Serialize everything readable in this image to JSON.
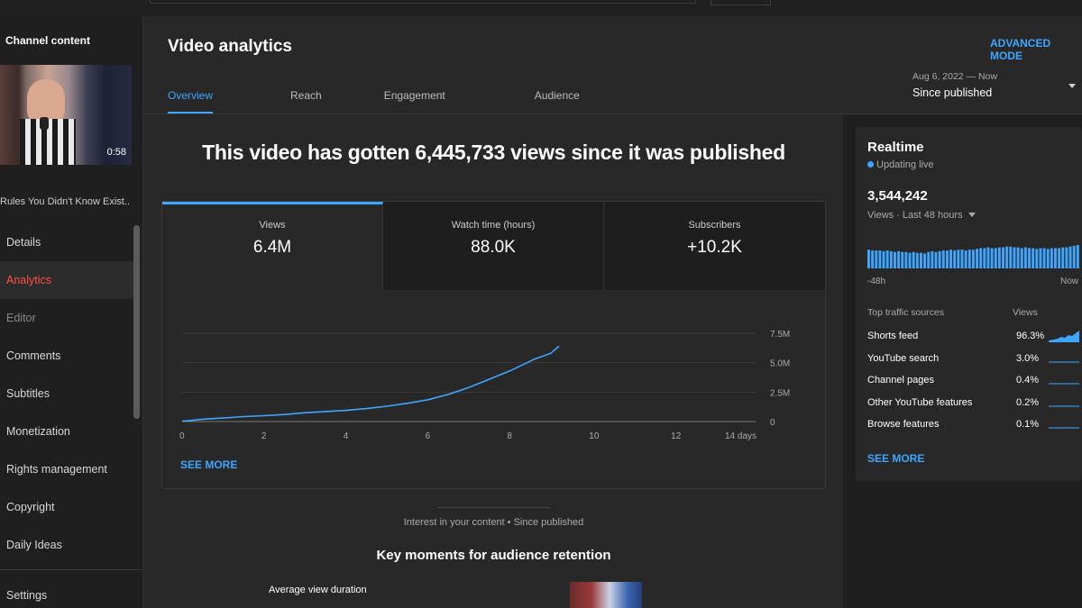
{
  "sidebar": {
    "title": "Channel content",
    "video_duration": "0:58",
    "video_title": "Rules You Didn't Know Exist..",
    "nav": [
      {
        "label": "Details",
        "state": "normal"
      },
      {
        "label": "Analytics",
        "state": "active"
      },
      {
        "label": "Editor",
        "state": "disabled"
      },
      {
        "label": "Comments",
        "state": "normal"
      },
      {
        "label": "Subtitles",
        "state": "normal"
      },
      {
        "label": "Monetization",
        "state": "normal"
      },
      {
        "label": "Rights management",
        "state": "normal"
      },
      {
        "label": "Copyright",
        "state": "normal"
      },
      {
        "label": "Daily Ideas",
        "state": "normal"
      }
    ],
    "settings": "Settings"
  },
  "header": {
    "title": "Video analytics",
    "advanced_mode": "ADVANCED MODE",
    "tabs": [
      {
        "label": "Overview",
        "active": true
      },
      {
        "label": "Reach",
        "active": false
      },
      {
        "label": "Engagement",
        "active": false
      },
      {
        "label": "Audience",
        "active": false
      }
    ],
    "date_range_sub": "Aug 6, 2022 — Now",
    "date_range": "Since published"
  },
  "main": {
    "headline": "This video has gotten 6,445,733 views since it was published",
    "metrics": [
      {
        "label": "Views",
        "value": "6.4M",
        "active": true
      },
      {
        "label": "Watch time (hours)",
        "value": "88.0K",
        "active": false
      },
      {
        "label": "Subscribers",
        "value": "+10.2K",
        "active": false
      }
    ],
    "see_more": "SEE MORE",
    "interest_caption": "Interest in your content • Since published",
    "retention_title": "Key moments for audience retention",
    "avg_view_duration": "Average view duration"
  },
  "chart_data": {
    "type": "line",
    "series": [
      {
        "x": [
          0,
          0.5,
          1,
          1.5,
          2,
          2.5,
          3,
          3.5,
          4,
          4.5,
          5,
          5.5,
          6,
          6.5,
          7,
          7.5,
          8,
          8.3,
          8.6,
          9.0,
          9.2
        ],
        "values": [
          0.02,
          0.2,
          0.3,
          0.42,
          0.5,
          0.6,
          0.75,
          0.85,
          0.95,
          1.1,
          1.3,
          1.55,
          1.85,
          2.3,
          2.9,
          3.6,
          4.3,
          4.8,
          5.3,
          5.8,
          6.4
        ]
      }
    ],
    "x_ticks": [
      "0",
      "2",
      "4",
      "6",
      "8",
      "10",
      "12",
      "14 days"
    ],
    "y_ticks": [
      "0",
      "2.5M",
      "5.0M",
      "7.5M"
    ],
    "xlim": [
      0,
      14
    ],
    "ylim": [
      0,
      7.5
    ],
    "y_unit": "M",
    "grid": true,
    "line_color": "#3ea6ff"
  },
  "realtime": {
    "title": "Realtime",
    "status": "Updating live",
    "views": "3,544,242",
    "views_sub": "Views · Last 48 hours",
    "axis_left": "-48h",
    "axis_right": "Now",
    "bars": [
      24,
      23,
      23,
      23,
      22,
      23,
      22,
      21,
      22,
      21,
      21,
      20,
      21,
      20,
      20,
      19,
      21,
      22,
      21,
      22,
      23,
      23,
      24,
      23,
      24,
      24,
      23,
      24,
      24,
      25,
      26,
      26,
      27,
      26,
      26,
      27,
      27,
      28,
      28,
      27,
      27,
      26,
      27,
      26,
      26,
      25,
      26,
      26,
      25,
      26,
      26,
      26,
      27,
      27,
      28,
      29,
      30
    ],
    "traffic_header": "Top traffic sources",
    "traffic_header_right": "Views",
    "sources": [
      {
        "name": "Shorts feed",
        "pct": "96.3%"
      },
      {
        "name": "YouTube search",
        "pct": "3.0%"
      },
      {
        "name": "Channel pages",
        "pct": "0.4%"
      },
      {
        "name": "Other YouTube features",
        "pct": "0.2%"
      },
      {
        "name": "Browse features",
        "pct": "0.1%"
      }
    ],
    "see_more": "SEE MORE",
    "accent": "#3ea6ff"
  }
}
